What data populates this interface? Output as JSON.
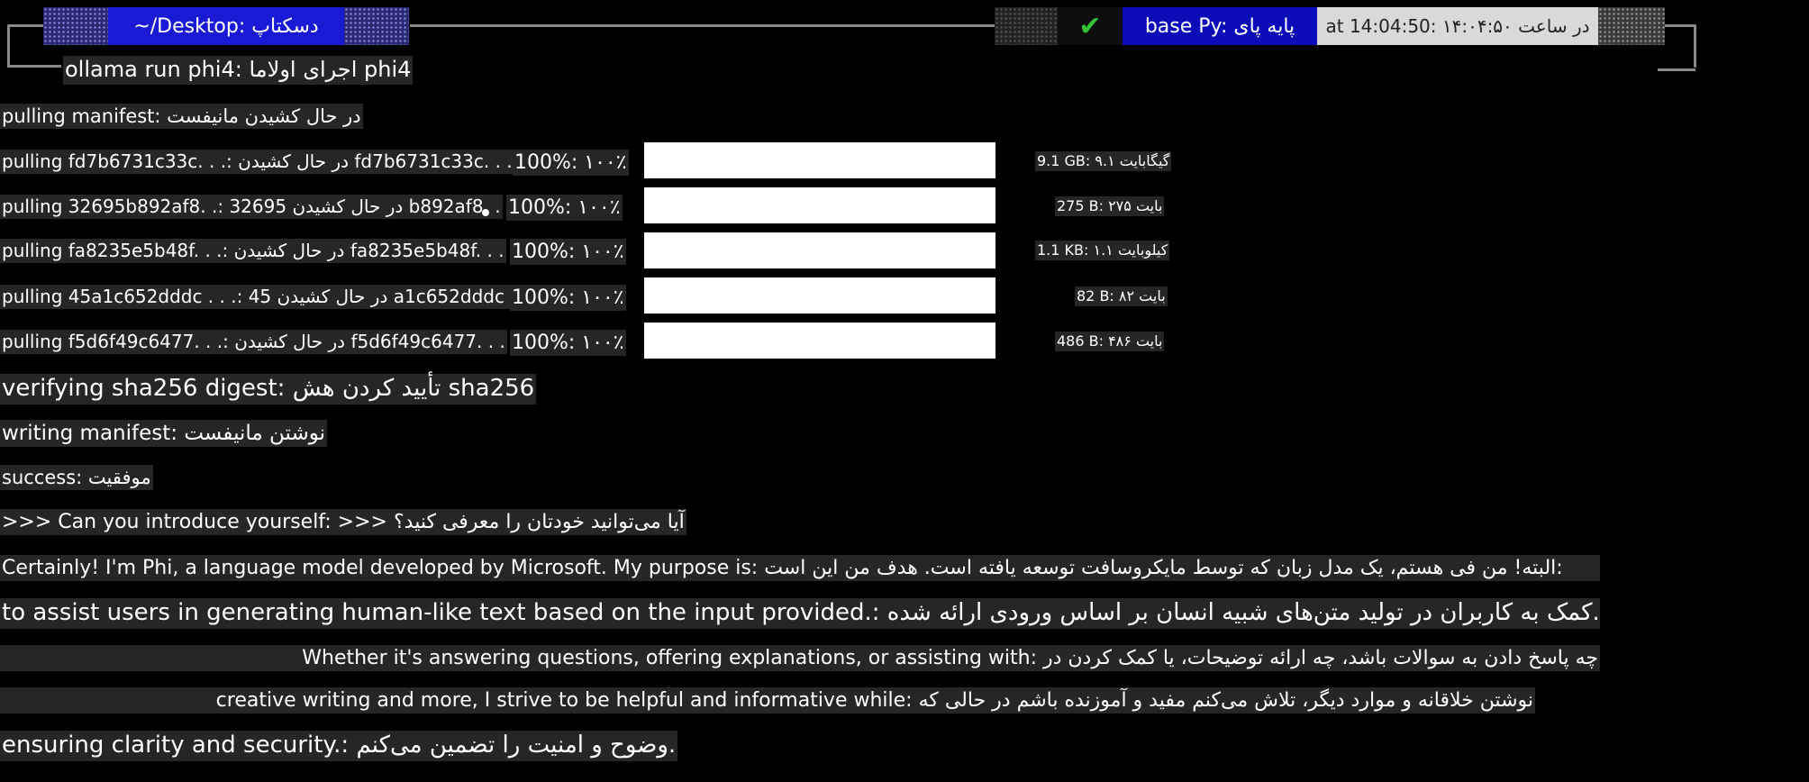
{
  "prompt": {
    "directory": "~/Desktop: دسکتاپ",
    "status_check": "✔",
    "environment": "base Py: پایه پای",
    "time": "at 14:04:50: ۱۴:۰۴:۵۰ در ساعت"
  },
  "command": "ollama run phi4: اجرای اولاما phi4",
  "pulling_manifest": "pulling manifest: در حال کشیدن مانیفست",
  "downloads": [
    {
      "label": "pulling fd7b6731c33c. . .: در حال کشیدن fd7b6731c33c. . .",
      "percent_text": "100%: ۱۰۰٪",
      "progress": 1.0,
      "size": "9.1 GB: ۹.۱ گیگابایت"
    },
    {
      "label": "pulling 32695b892af8. .: 32695 در حال کشیدن b892af8. .",
      "percent_text": "100%: ۱۰۰٪",
      "progress": 1.0,
      "size": "275 B: ۲۷۵ بایت"
    },
    {
      "label": "pulling fa8235e5b48f. . .: در حال کشیدن fa8235e5b48f. . .",
      "percent_text": "100%: ۱۰۰٪",
      "progress": 1.0,
      "size": "1.1 KB: ۱.۱ کیلوبایت"
    },
    {
      "label": "pulling 45a1c652dddc . . .: 45 در حال کشیدن a1c652dddc . . .",
      "percent_text": "100%: ۱۰۰٪",
      "progress": 1.0,
      "size": "82 B: ۸۲ بایت"
    },
    {
      "label": "pulling f5d6f49c6477. . .: در حال کشیدن f5d6f49c6477. . .",
      "percent_text": "100%: ۱۰۰٪",
      "progress": 1.0,
      "size": "486 B: ۴۸۶ بایت"
    }
  ],
  "verifying": "verifying sha256 digest: تأیید کردن هش sha256",
  "writing": "writing manifest: نوشتن مانیفست",
  "success": "success: موفقیت",
  "question": ">>> Can you introduce yourself: >>> آیا می‌توانید خودتان را معرفی کنید؟",
  "response": [
    "Certainly! I'm Phi, a language model developed by Microsoft. My purpose is: البته! من فی هستم، یک مدل زبان که توسط مایکروسافت توسعه یافته است. هدف من این است:",
    "to assist users in generating human-like text based on the input provided.: کمک به کاربران در تولید متن‌های شبیه انسان بر اساس ورودی ارائه شده.",
    "Whether it's answering questions, offering explanations, or assisting with: چه پاسخ دادن به سوالات باشد، چه ارائه توضیحات، یا کمک کردن در",
    "creative writing and more, I strive to be helpful and informative while: نوشتن خلاقانه و موارد دیگر، تلاش می‌کنم مفید و آموزنده باشم در حالی که",
    "ensuring clarity and security.: وضوح و امنیت را تضمین می‌کنم."
  ]
}
